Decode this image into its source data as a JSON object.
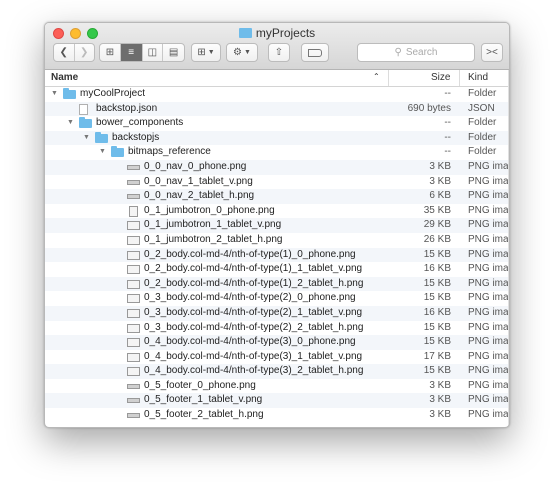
{
  "window": {
    "title": "myProjects"
  },
  "toolbar": {
    "search_placeholder": "Search"
  },
  "columns": {
    "name": "Name",
    "size": "Size",
    "kind": "Kind"
  },
  "rows": [
    {
      "name": "myCoolProject",
      "size": "--",
      "kind": "Folder",
      "type": "folder",
      "level": 0,
      "expanded": true
    },
    {
      "name": "backstop.json",
      "size": "690 bytes",
      "kind": "JSON",
      "type": "doc",
      "level": 1
    },
    {
      "name": "bower_components",
      "size": "--",
      "kind": "Folder",
      "type": "folder",
      "level": 1,
      "expanded": true
    },
    {
      "name": "backstopjs",
      "size": "--",
      "kind": "Folder",
      "type": "folder",
      "level": 2,
      "expanded": true
    },
    {
      "name": "bitmaps_reference",
      "size": "--",
      "kind": "Folder",
      "type": "folder",
      "level": 3,
      "expanded": true
    },
    {
      "name": "0_0_nav_0_phone.png",
      "size": "3 KB",
      "kind": "PNG ima",
      "type": "nav",
      "level": 4
    },
    {
      "name": "0_0_nav_1_tablet_v.png",
      "size": "3 KB",
      "kind": "PNG ima",
      "type": "nav",
      "level": 4
    },
    {
      "name": "0_0_nav_2_tablet_h.png",
      "size": "6 KB",
      "kind": "PNG ima",
      "type": "nav",
      "level": 4
    },
    {
      "name": "0_1_jumbotron_0_phone.png",
      "size": "35 KB",
      "kind": "PNG ima",
      "type": "tall",
      "level": 4
    },
    {
      "name": "0_1_jumbotron_1_tablet_v.png",
      "size": "29 KB",
      "kind": "PNG ima",
      "type": "img",
      "level": 4
    },
    {
      "name": "0_1_jumbotron_2_tablet_h.png",
      "size": "26 KB",
      "kind": "PNG ima",
      "type": "img",
      "level": 4
    },
    {
      "name": "0_2_body.col-md-4/nth-of-type(1)_0_phone.png",
      "size": "15 KB",
      "kind": "PNG ima",
      "type": "img",
      "level": 4
    },
    {
      "name": "0_2_body.col-md-4/nth-of-type(1)_1_tablet_v.png",
      "size": "16 KB",
      "kind": "PNG ima",
      "type": "img",
      "level": 4
    },
    {
      "name": "0_2_body.col-md-4/nth-of-type(1)_2_tablet_h.png",
      "size": "15 KB",
      "kind": "PNG ima",
      "type": "img",
      "level": 4
    },
    {
      "name": "0_3_body.col-md-4/nth-of-type(2)_0_phone.png",
      "size": "15 KB",
      "kind": "PNG ima",
      "type": "img",
      "level": 4
    },
    {
      "name": "0_3_body.col-md-4/nth-of-type(2)_1_tablet_v.png",
      "size": "16 KB",
      "kind": "PNG ima",
      "type": "img",
      "level": 4
    },
    {
      "name": "0_3_body.col-md-4/nth-of-type(2)_2_tablet_h.png",
      "size": "15 KB",
      "kind": "PNG ima",
      "type": "img",
      "level": 4
    },
    {
      "name": "0_4_body.col-md-4/nth-of-type(3)_0_phone.png",
      "size": "15 KB",
      "kind": "PNG ima",
      "type": "img",
      "level": 4
    },
    {
      "name": "0_4_body.col-md-4/nth-of-type(3)_1_tablet_v.png",
      "size": "17 KB",
      "kind": "PNG ima",
      "type": "img",
      "level": 4
    },
    {
      "name": "0_4_body.col-md-4/nth-of-type(3)_2_tablet_h.png",
      "size": "15 KB",
      "kind": "PNG ima",
      "type": "img",
      "level": 4
    },
    {
      "name": "0_5_footer_0_phone.png",
      "size": "3 KB",
      "kind": "PNG ima",
      "type": "nav",
      "level": 4
    },
    {
      "name": "0_5_footer_1_tablet_v.png",
      "size": "3 KB",
      "kind": "PNG ima",
      "type": "nav",
      "level": 4
    },
    {
      "name": "0_5_footer_2_tablet_h.png",
      "size": "3 KB",
      "kind": "PNG ima",
      "type": "nav",
      "level": 4
    }
  ]
}
